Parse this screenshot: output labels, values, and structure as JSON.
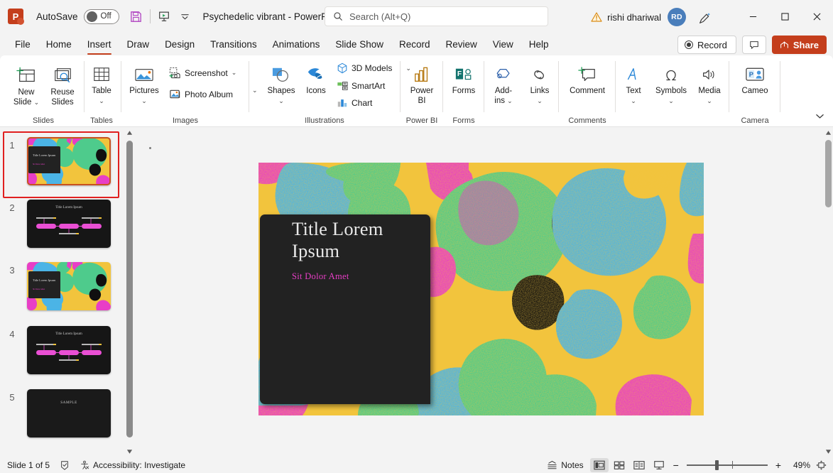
{
  "titlebar": {
    "app_icon": "powerpoint-logo",
    "app_letter": "P",
    "autosave_label": "AutoSave",
    "autosave_state": "Off",
    "save_icon": "save-icon",
    "present_icon": "start-presentation-icon",
    "customize_qat_icon": "chevron-down-icon",
    "document_title": "Psychedelic vibrant  -  PowerPoint",
    "search_placeholder": "Search (Alt+Q)",
    "search_icon": "search-icon",
    "alert_icon": "warning-icon",
    "account_name": "rishi dhariwal",
    "avatar_initials": "RD",
    "ink_icon": "pen-ink-icon",
    "minimize_icon": "minimize-icon",
    "maximize_icon": "maximize-icon",
    "close_icon": "close-icon"
  },
  "tabs": [
    {
      "label": "File",
      "active": false
    },
    {
      "label": "Home",
      "active": false
    },
    {
      "label": "Insert",
      "active": true
    },
    {
      "label": "Draw",
      "active": false
    },
    {
      "label": "Design",
      "active": false
    },
    {
      "label": "Transitions",
      "active": false
    },
    {
      "label": "Animations",
      "active": false
    },
    {
      "label": "Slide Show",
      "active": false
    },
    {
      "label": "Record",
      "active": false
    },
    {
      "label": "Review",
      "active": false
    },
    {
      "label": "View",
      "active": false
    },
    {
      "label": "Help",
      "active": false
    }
  ],
  "tab_actions": {
    "record_label": "Record",
    "comments_icon": "comment-icon",
    "share_label": "Share",
    "share_icon": "share-arrow-icon"
  },
  "ribbon": {
    "collapse_icon": "chevron-down-icon",
    "groups": [
      {
        "name": "Slides",
        "label": "Slides",
        "items": [
          {
            "label": "New\nSlide",
            "icon": "new-slide-icon",
            "has_dropdown": true
          },
          {
            "label": "Reuse\nSlides",
            "icon": "reuse-slides-icon",
            "has_dropdown": false
          }
        ]
      },
      {
        "name": "Tables",
        "label": "Tables",
        "items": [
          {
            "label": "Table",
            "icon": "table-icon",
            "has_dropdown": true
          }
        ]
      },
      {
        "name": "Images",
        "label": "Images",
        "items": [
          {
            "label": "Pictures",
            "icon": "pictures-icon",
            "has_dropdown": true
          },
          {
            "label": "Screenshot",
            "icon": "screenshot-icon",
            "has_dropdown": true
          },
          {
            "label": "Photo Album",
            "icon": "photo-album-icon",
            "has_dropdown": false
          }
        ]
      },
      {
        "name": "Illustrations",
        "label": "Illustrations",
        "items": [
          {
            "label": "Shapes",
            "icon": "shapes-icon",
            "has_dropdown": true
          },
          {
            "label": "Icons",
            "icon": "icons-icon",
            "has_dropdown": false
          },
          {
            "label": "3D Models",
            "icon": "3d-models-icon",
            "has_dropdown": true
          },
          {
            "label": "SmartArt",
            "icon": "smartart-icon",
            "has_dropdown": false
          },
          {
            "label": "Chart",
            "icon": "chart-icon",
            "has_dropdown": false
          }
        ]
      },
      {
        "name": "PowerBI",
        "label": "Power BI",
        "items": [
          {
            "label": "Power\nBI",
            "icon": "power-bi-icon",
            "has_dropdown": false
          }
        ]
      },
      {
        "name": "Forms",
        "label": "Forms",
        "items": [
          {
            "label": "Forms",
            "icon": "forms-icon",
            "has_dropdown": false
          }
        ]
      },
      {
        "name": "AddinsLinks",
        "label": "",
        "items": [
          {
            "label": "Add-\nins",
            "icon": "add-ins-icon",
            "has_dropdown": true
          },
          {
            "label": "Links",
            "icon": "links-icon",
            "has_dropdown": true
          }
        ]
      },
      {
        "name": "Comments",
        "label": "Comments",
        "items": [
          {
            "label": "Comment",
            "icon": "new-comment-icon",
            "has_dropdown": false
          }
        ]
      },
      {
        "name": "TextSymbolsMedia",
        "label": "",
        "items": [
          {
            "label": "Text",
            "icon": "text-icon",
            "has_dropdown": true
          },
          {
            "label": "Symbols",
            "icon": "symbols-omega-icon",
            "has_dropdown": true
          },
          {
            "label": "Media",
            "icon": "media-speaker-icon",
            "has_dropdown": true
          }
        ]
      },
      {
        "name": "Camera",
        "label": "Camera",
        "items": [
          {
            "label": "Cameo",
            "icon": "cameo-icon",
            "has_dropdown": false
          }
        ]
      }
    ],
    "group_labels": [
      "Slides",
      "Tables",
      "Images",
      "Illustrations",
      "Power BI",
      "Forms",
      "Comments",
      "Camera"
    ]
  },
  "slide_panel": {
    "slides": [
      {
        "number": "1",
        "type": "title-psychedelic",
        "title": "Title Lorem Ipsum",
        "subtitle": "Sit Dolor Amet",
        "selected": true
      },
      {
        "number": "2",
        "type": "dark-diagram",
        "title": "Title Lorem Ipsum",
        "selected": false
      },
      {
        "number": "3",
        "type": "title-psychedelic",
        "title": "Title Lorem Ipsum",
        "subtitle": "Sit Dolor Amet",
        "selected": false
      },
      {
        "number": "4",
        "type": "dark-diagram",
        "title": "Title Lorem Ipsum",
        "selected": false
      },
      {
        "number": "5",
        "type": "dark-sample",
        "title": "SAMPLE",
        "selected": false
      }
    ],
    "scroll_up_icon": "scroll-up-arrow-icon",
    "scroll_down_icon": "scroll-down-arrow-icon"
  },
  "slide": {
    "title": "Title Lorem\nIpsum",
    "title_line1": "Title Lorem",
    "title_line2": "Ipsum",
    "subtitle": "Sit Dolor Amet",
    "title_color": "#e8e8e8",
    "subtitle_color": "#e83ec6",
    "card_color": "#222222",
    "palette": {
      "magenta": "#e83ec6",
      "yellow": "#f2c43d",
      "cyan": "#4bb4e6",
      "green": "#4ecb8c",
      "black": "#101010"
    }
  },
  "statusbar": {
    "slide_counter": "Slide 1 of 5",
    "spellcheck_icon": "spellcheck-icon",
    "accessibility_icon": "accessibility-icon",
    "accessibility_label": "Accessibility: Investigate",
    "notes_label": "Notes",
    "notes_icon": "notes-icon",
    "views": [
      {
        "name": "normal-view",
        "icon": "normal-view-icon",
        "active": true
      },
      {
        "name": "slide-sorter-view",
        "icon": "slide-sorter-icon",
        "active": false
      },
      {
        "name": "reading-view",
        "icon": "reading-view-icon",
        "active": false
      },
      {
        "name": "slide-show-view",
        "icon": "slide-show-icon",
        "active": false
      }
    ],
    "zoom_out_label": "−",
    "zoom_in_label": "+",
    "zoom_percent": "49%",
    "fit_icon": "fit-slide-icon"
  }
}
